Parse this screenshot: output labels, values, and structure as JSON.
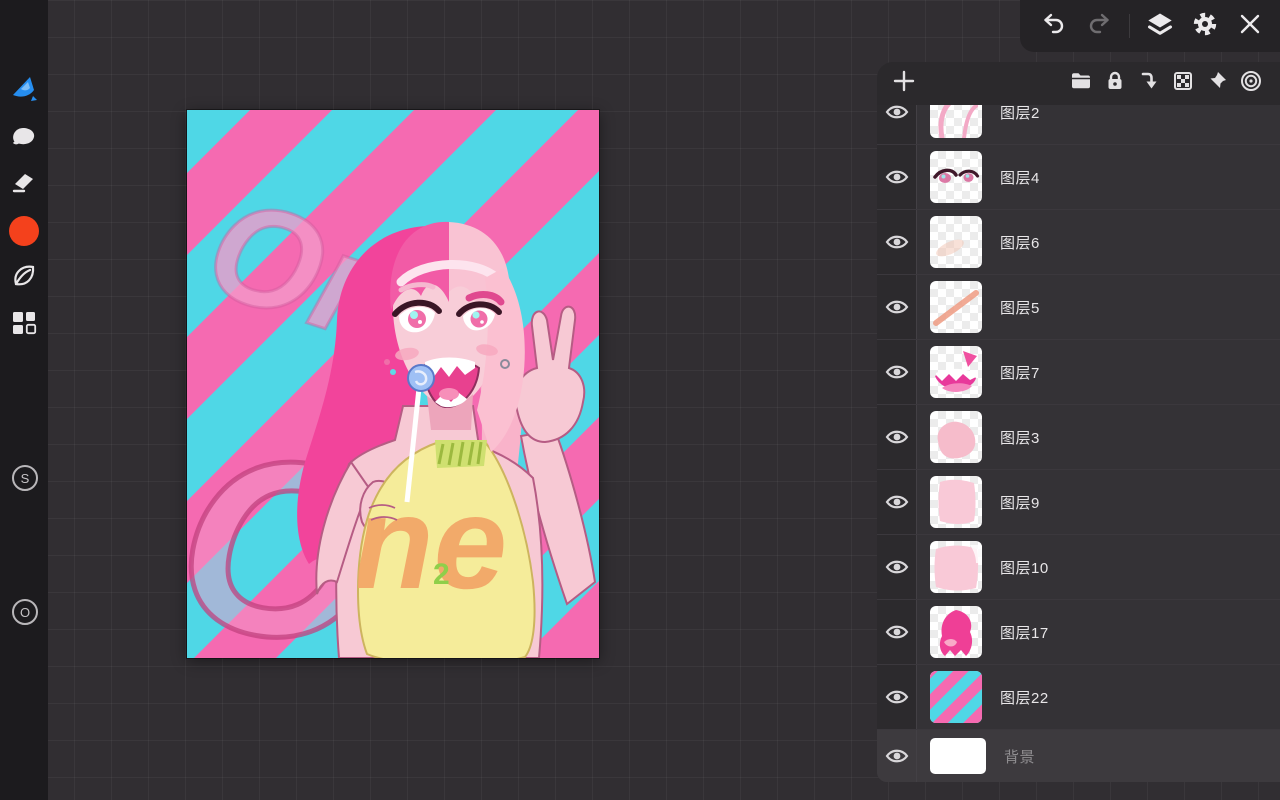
{
  "colors": {
    "accent_blue": "#268ef0",
    "swatch_orange": "#f4411c",
    "stripe_pink": "#f56ab1",
    "stripe_cyan": "#4fd7e6",
    "selected_row": "#3d3a3e"
  },
  "top_toolbar": {
    "icons": [
      "undo",
      "redo",
      "layers",
      "settings",
      "close"
    ]
  },
  "sidebar": {
    "tools": [
      "paint-tool",
      "smudge-tool",
      "eraser-tool",
      "color-swatch",
      "leaf-tool",
      "assets-tool"
    ],
    "size_label": "S",
    "opacity_label": "O"
  },
  "canvas": {
    "watermark_top": "One",
    "watermark_bottom": "O",
    "shirt_text": "ne",
    "shirt_mark": "2"
  },
  "layers_panel": {
    "header_icons": [
      "add-layer",
      "folder",
      "lock",
      "merge-down",
      "transparency",
      "pin",
      "clipping"
    ],
    "rows": [
      {
        "label": "图层2",
        "visible": true
      },
      {
        "label": "图层4",
        "visible": true
      },
      {
        "label": "图层6",
        "visible": true
      },
      {
        "label": "图层5",
        "visible": true
      },
      {
        "label": "图层7",
        "visible": true
      },
      {
        "label": "图层3",
        "visible": true
      },
      {
        "label": "图层9",
        "visible": true
      },
      {
        "label": "图层10",
        "visible": true
      },
      {
        "label": "图层17",
        "visible": true
      },
      {
        "label": "图层22",
        "visible": true
      },
      {
        "label": "背景",
        "visible": true,
        "selected": true
      }
    ]
  }
}
